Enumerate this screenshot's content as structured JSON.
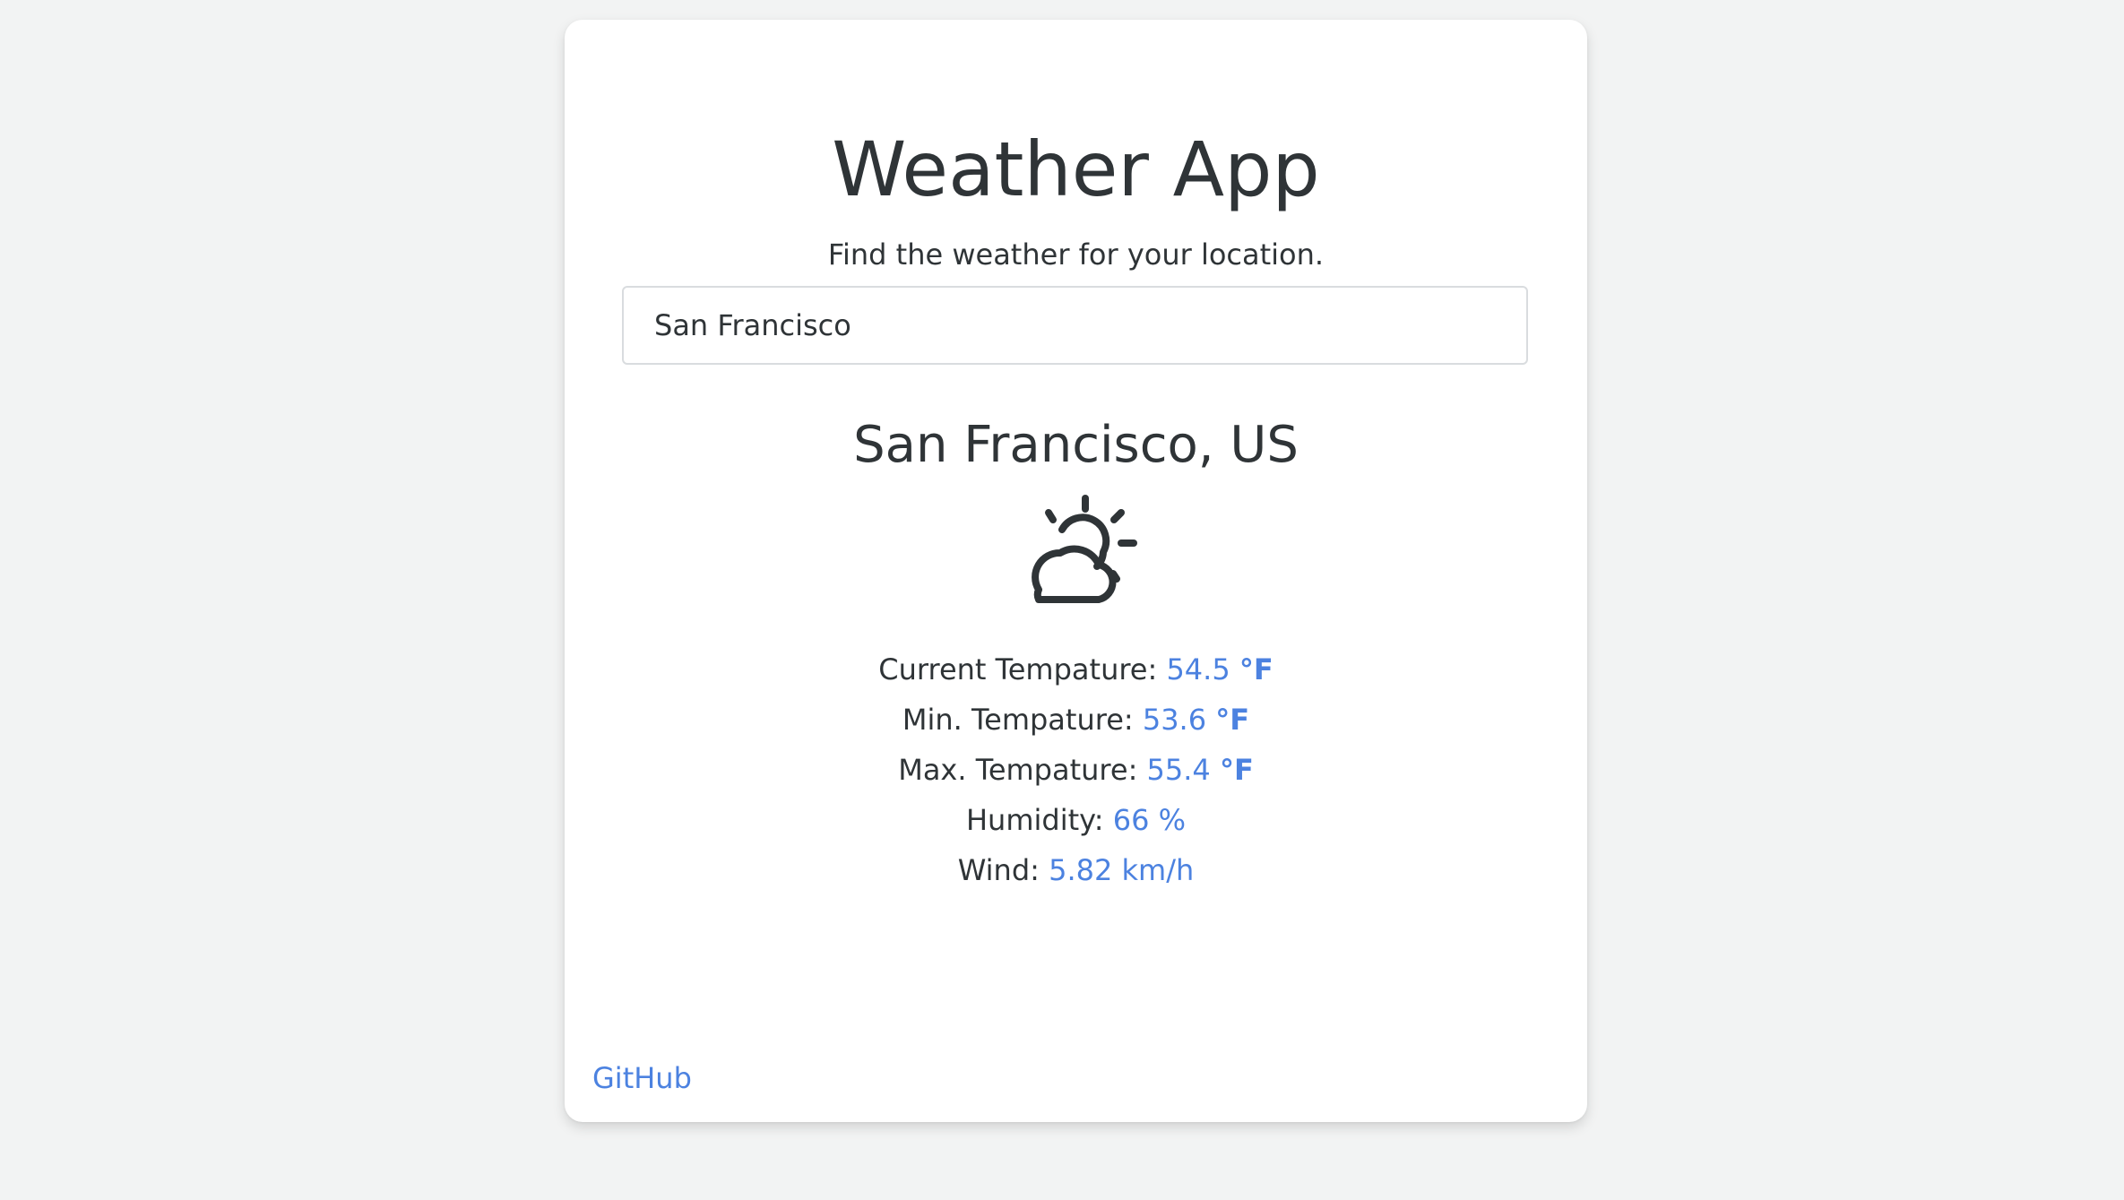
{
  "app": {
    "title": "Weather App",
    "subtitle": "Find the weather for your location."
  },
  "search": {
    "value": "San Francisco"
  },
  "result": {
    "location": "San Francisco, US",
    "icon": "partly-cloudy-icon",
    "current_label": "Current Tempature:",
    "current_value": "54.5",
    "min_label": "Min. Tempature:",
    "min_value": "53.6",
    "max_label": "Max. Tempature:",
    "max_value": "55.4",
    "temp_unit": "°F",
    "humidity_label": "Humidity:",
    "humidity_value": "66 %",
    "wind_label": "Wind:",
    "wind_value": "5.82 km/h"
  },
  "footer": {
    "github_link": "GitHub"
  },
  "colors": {
    "background": "#f2f3f3",
    "card": "#ffffff",
    "text": "#2f3437",
    "accent": "#4c82e0"
  }
}
